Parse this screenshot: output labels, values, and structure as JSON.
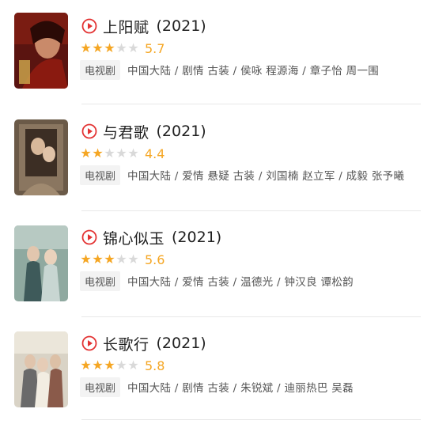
{
  "colors": {
    "play": "#e33333",
    "star_on": "#f5a623",
    "star_off": "#d9d9d9",
    "score": "#f5a623"
  },
  "items": [
    {
      "title": "上阳赋",
      "year": "(2021)",
      "stars": 3,
      "score": "5.7",
      "tag": "电视剧",
      "meta": "中国大陆 / 剧情 古装 / 侯咏 程源海 / 章子怡 周一围",
      "poster": "poster-dark-red"
    },
    {
      "title": "与君歌",
      "year": "(2021)",
      "stars": 2,
      "score": "4.4",
      "tag": "电视剧",
      "meta": "中国大陆 / 爱情 悬疑 古装 / 刘国楠 赵立军 / 成毅 张予曦",
      "poster": "poster-sepia"
    },
    {
      "title": "锦心似玉",
      "year": "(2021)",
      "stars": 3,
      "score": "5.6",
      "tag": "电视剧",
      "meta": "中国大陆 / 爱情 古装 / 温德光 / 钟汉良 谭松韵",
      "poster": "poster-teal"
    },
    {
      "title": "长歌行",
      "year": "(2021)",
      "stars": 3,
      "score": "5.8",
      "tag": "电视剧",
      "meta": "中国大陆 / 剧情 古装 / 朱锐斌 / 迪丽热巴 吴磊",
      "poster": "poster-pale"
    }
  ]
}
